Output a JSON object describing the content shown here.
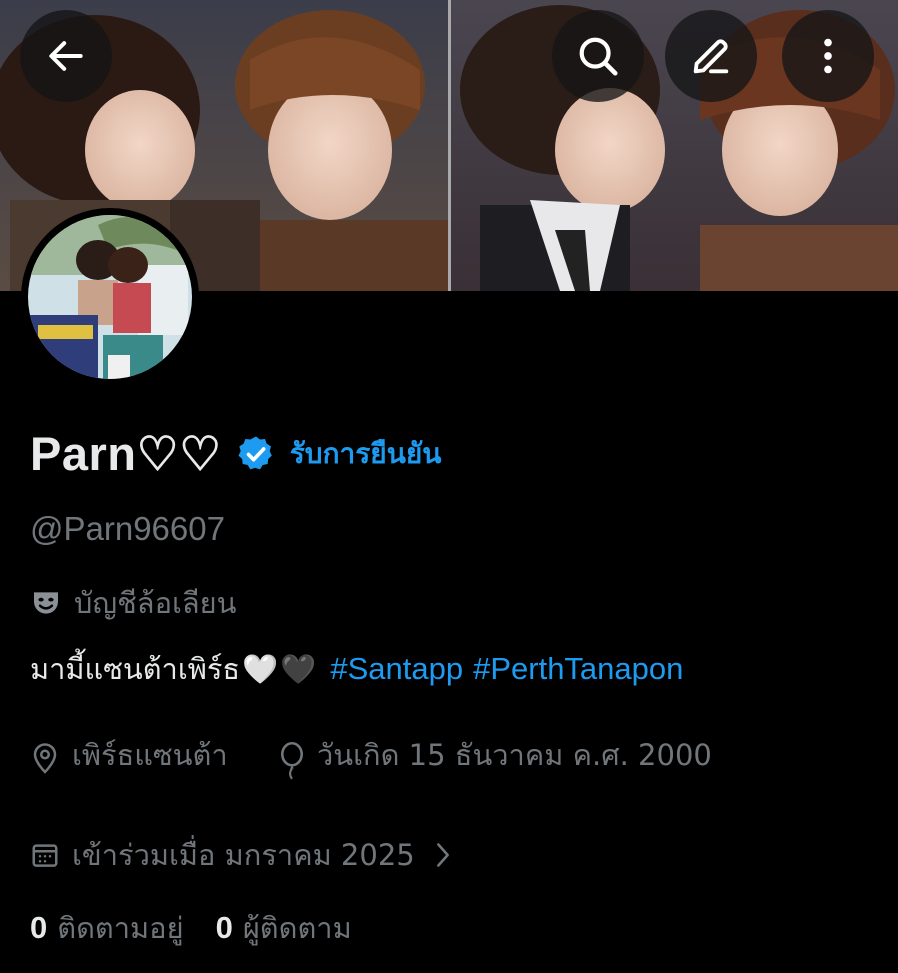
{
  "profile": {
    "display_name": "Parn♡♡",
    "verify_link": "รับการยืนยัน",
    "handle": "@Parn96607",
    "parody_label": "บัญชีล้อเลียน",
    "bio_text": "มามี้แซนต้าเพิร์ธ",
    "bio_hearts": [
      "🤍",
      "🖤"
    ],
    "hashtags": [
      "#Santapp",
      "#PerthTanapon"
    ],
    "location": "เพิร์ธแซนต้า",
    "birthday": "วันเกิด 15 ธันวาคม ค.ศ. 2000",
    "joined": "เข้าร่วมเมื่อ มกราคม 2025",
    "following_count": "0",
    "following_label": "ติดตามอยู่",
    "followers_count": "0",
    "followers_label": "ผู้ติดตาม"
  },
  "colors": {
    "background": "#000000",
    "primary_text": "#e7e9ea",
    "secondary_text": "#71767b",
    "accent": "#1d9bf0"
  },
  "icons": {
    "back": "arrow-left-icon",
    "search": "search-icon",
    "edit": "edit-pencil-icon",
    "more": "more-vertical-icon",
    "verified": "verified-badge-icon",
    "parody": "theater-mask-icon",
    "location": "location-pin-icon",
    "birthday": "balloon-icon",
    "calendar": "calendar-icon",
    "chevron": "chevron-right-icon"
  }
}
